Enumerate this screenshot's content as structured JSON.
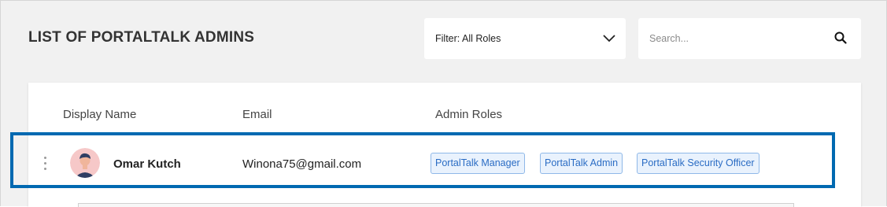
{
  "header": {
    "title": "LIST OF PORTALTALK ADMINS"
  },
  "filter": {
    "label": "Filter: All Roles",
    "icon": "chevron-down-icon"
  },
  "search": {
    "placeholder": "Search...",
    "value": "",
    "icon": "search-icon"
  },
  "table": {
    "columns": [
      "Display Name",
      "Email",
      "Admin Roles"
    ],
    "rows": [
      {
        "name": "Omar Kutch",
        "email": "Winona75@gmail.com",
        "avatar": "avatar-illustration",
        "roles": [
          "PortalTalk Manager",
          "PortalTalk Admin",
          "PortalTalk Security Officer"
        ]
      }
    ]
  },
  "colors": {
    "background": "#f1f1f1",
    "highlight_border": "#0069b1",
    "chip_border": "#8fb8e8",
    "chip_text": "#2a6cc4",
    "chip_bg": "#e9f2fd"
  }
}
